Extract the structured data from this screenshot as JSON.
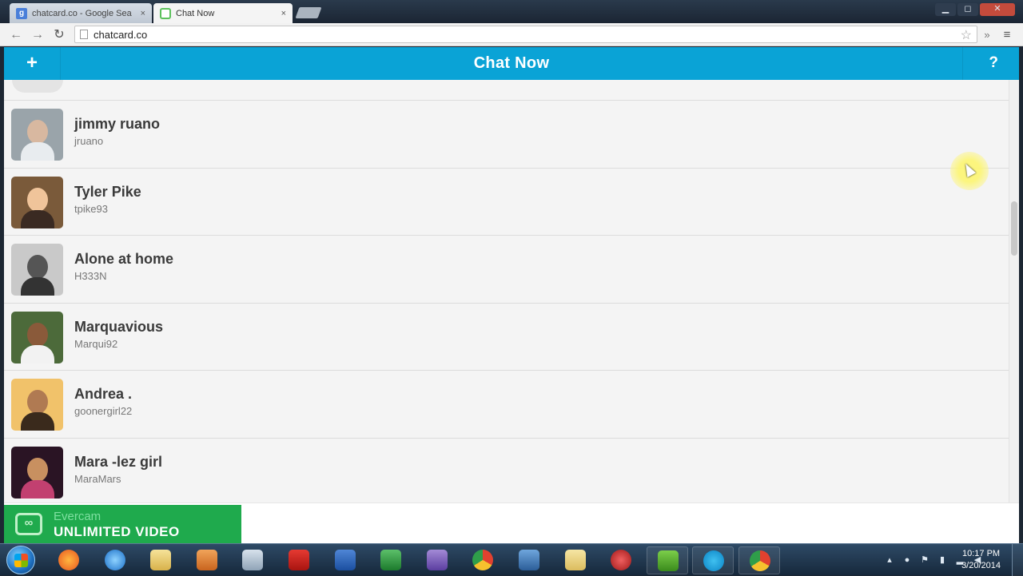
{
  "browser": {
    "tabs": [
      {
        "label": "chatcard.co - Google Sea",
        "active": false,
        "favicon": "google-icon"
      },
      {
        "label": "Chat Now",
        "active": true,
        "favicon": "chatcard-icon"
      }
    ],
    "tab_close": "×",
    "url": "chatcard.co",
    "window_controls": {
      "minimize": "▁",
      "maximize": "◻",
      "close": "✕"
    }
  },
  "app": {
    "title": "Chat Now",
    "add_label": "+",
    "help_label": "?",
    "accent_color": "#0aa3d6"
  },
  "contacts": [
    {
      "name": "jimmy ruano",
      "handle": "jruano",
      "avatar_bg": "#9aa4aa",
      "skin": "#d8b8a0",
      "shirt": "#e8ecef"
    },
    {
      "name": "Tyler Pike",
      "handle": "tpike93",
      "avatar_bg": "#7a5a3a",
      "skin": "#f0c49a",
      "shirt": "#3a2a22"
    },
    {
      "name": "Alone at home",
      "handle": "H333N",
      "avatar_bg": "#c9c9c9",
      "skin": "#555555",
      "shirt": "#333333"
    },
    {
      "name": "Marquavious",
      "handle": "Marqui92",
      "avatar_bg": "#4c6a3a",
      "skin": "#8a5a3a",
      "shirt": "#f2f2f2"
    },
    {
      "name": "Andrea .",
      "handle": "goonergirl22",
      "avatar_bg": "#f1c26a",
      "skin": "#b07a52",
      "shirt": "#3a2a1c"
    },
    {
      "name": "Mara -lez girl",
      "handle": "MaraMars",
      "avatar_bg": "#2a1424",
      "skin": "#c89060",
      "shirt": "#c24070"
    }
  ],
  "overlay": {
    "brand": "Evercam",
    "tagline": "UNLIMITED VIDEO",
    "color": "#1faa4d"
  },
  "taskbar": {
    "apps": [
      "firefox-icon",
      "internet-explorer-icon",
      "file-explorer-icon",
      "media-player-icon",
      "calculator-icon",
      "acrobat-icon",
      "word-icon",
      "excel-icon",
      "visual-studio-icon",
      "chrome-icon",
      "network-icon",
      "folder-icon",
      "downloader-icon",
      "utorrent-icon",
      "skype-icon",
      "chrome-icon"
    ],
    "time": "10:17 PM",
    "date": "3/20/2014"
  }
}
